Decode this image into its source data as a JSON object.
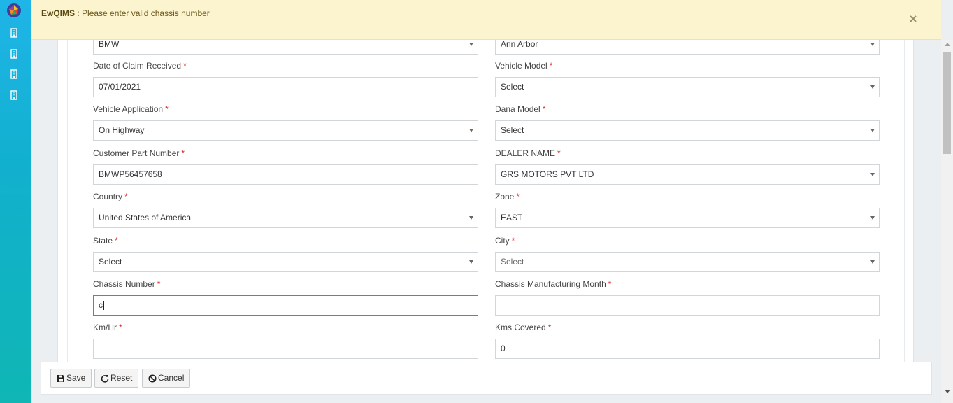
{
  "alert": {
    "app_name": "EwQIMS",
    "separator": " : ",
    "message": "Please enter valid chassis number"
  },
  "sidebar": {
    "items": [
      {
        "icon": "building-icon"
      },
      {
        "icon": "building-icon"
      },
      {
        "icon": "building-icon"
      },
      {
        "icon": "building-icon"
      }
    ]
  },
  "form": {
    "required_marker": "*",
    "left": {
      "make": {
        "value": "BMW"
      },
      "date_of_claim": {
        "label": "Date of Claim Received",
        "value": "07/01/2021"
      },
      "vehicle_application": {
        "label": "Vehicle Application",
        "value": "On Highway"
      },
      "customer_part_number": {
        "label": "Customer Part Number",
        "value": "BMWP56457658"
      },
      "country": {
        "label": "Country",
        "value": "United States of America"
      },
      "state": {
        "label": "State",
        "value": "Select"
      },
      "chassis_number": {
        "label": "Chassis Number",
        "value": "c"
      },
      "km_hr": {
        "label": "Km/Hr",
        "value": ""
      }
    },
    "right": {
      "location": {
        "value": "Ann Arbor"
      },
      "vehicle_model": {
        "label": "Vehicle Model",
        "value": "Select"
      },
      "dana_model": {
        "label": "Dana Model",
        "value": "Select"
      },
      "dealer_name": {
        "label": "DEALER NAME",
        "value": "GRS MOTORS PVT LTD"
      },
      "zone": {
        "label": "Zone",
        "value": "EAST"
      },
      "city": {
        "label": "City",
        "value": "Select"
      },
      "chassis_mfg_month": {
        "label": "Chassis Manufacturing Month",
        "value": ""
      },
      "kms_covered": {
        "label": "Kms Covered",
        "value": "0"
      }
    }
  },
  "footer": {
    "save_label": "Save",
    "reset_label": "Reset",
    "cancel_label": "Cancel"
  },
  "colors": {
    "alert_bg": "#fcf3cf",
    "sidebar_top": "#1fb5e8",
    "sidebar_bottom": "#0fb6b4",
    "required": "#d9262b",
    "focus_border": "#1aa89a"
  }
}
